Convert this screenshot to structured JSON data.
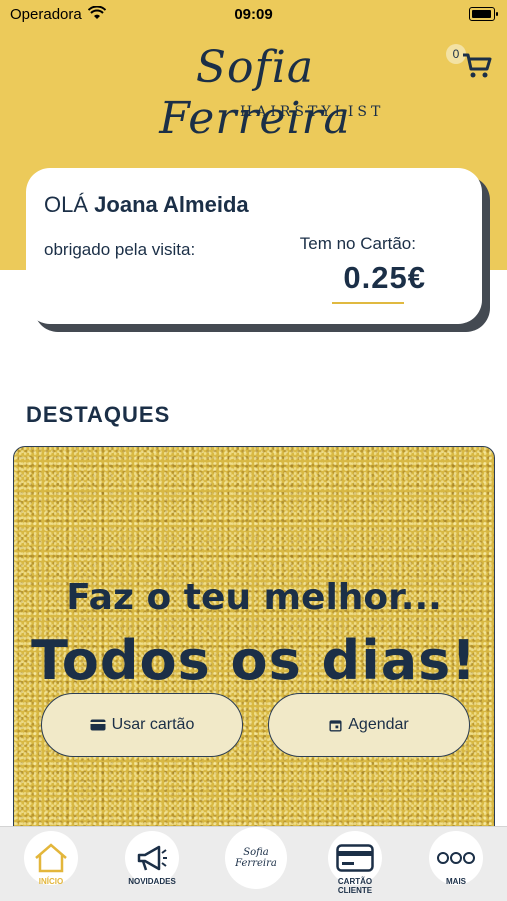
{
  "status_bar": {
    "carrier": "Operadora",
    "time": "09:09"
  },
  "brand": {
    "name": "Sofia Ferreira",
    "subtitle": "HAIRSTYLIST"
  },
  "cart": {
    "count": "0"
  },
  "card": {
    "greeting_prefix": "OLÁ",
    "customer_name": "Joana Almeida",
    "thanks": "obrigado pela visita:",
    "balance_label": "Tem no Cartão:",
    "balance_value": "0.25€"
  },
  "highlights": {
    "title": "DESTAQUES",
    "slogan_line1": "Faz o teu melhor...",
    "slogan_line2": "Todos os dias!",
    "use_card_label": "Usar cartão",
    "schedule_label": "Agendar"
  },
  "nav": {
    "items": [
      {
        "label": "INÍCIO",
        "icon": "home-icon"
      },
      {
        "label": "NOVIDADES",
        "icon": "megaphone-icon"
      },
      {
        "label": "Sofia Ferreira",
        "icon": "logo-icon"
      },
      {
        "label": "CARTÃO CLIENTE",
        "icon": "card-icon"
      },
      {
        "label": "MAIS",
        "icon": "more-icon"
      }
    ]
  },
  "colors": {
    "brand_yellow": "#ecca5a",
    "navy": "#1b2f47",
    "gold": "#d8b843"
  }
}
